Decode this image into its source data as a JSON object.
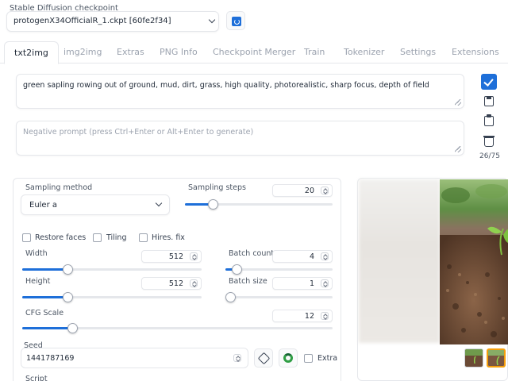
{
  "checkpoint": {
    "label": "Stable Diffusion checkpoint",
    "value": "protogenX34OfficialR_1.ckpt [60fe2f34]"
  },
  "tabs": [
    {
      "label": "txt2img",
      "active": true
    },
    {
      "label": "img2img"
    },
    {
      "label": "Extras"
    },
    {
      "label": "PNG Info"
    },
    {
      "label": "Checkpoint Merger"
    },
    {
      "label": "Train"
    },
    {
      "label": "Tokenizer"
    },
    {
      "label": "Settings"
    },
    {
      "label": "Extensions"
    }
  ],
  "prompt": {
    "value": "green sapling rowing out of ground, mud, dirt, grass, high quality, photorealistic, sharp focus, depth of field",
    "negative_placeholder": "Negative prompt (press Ctrl+Enter or Alt+Enter to generate)",
    "token_count": "26/75"
  },
  "tools": [
    {
      "icon": "checkbox-check-icon"
    },
    {
      "icon": "save-icon"
    },
    {
      "icon": "clipboard-icon"
    },
    {
      "icon": "trash-icon"
    }
  ],
  "sampling": {
    "method_label": "Sampling method",
    "method_value": "Euler a",
    "steps_label": "Sampling steps",
    "steps_value": "20",
    "steps_fraction": 0.19
  },
  "checkboxes": {
    "restore_faces": "Restore faces",
    "tiling": "Tiling",
    "hires": "Hires. fix"
  },
  "size": {
    "width_label": "Width",
    "width_value": "512",
    "width_fraction": 0.25,
    "height_label": "Height",
    "height_value": "512",
    "height_fraction": 0.25
  },
  "batch": {
    "count_label": "Batch count",
    "count_value": "4",
    "count_fraction": 0.1,
    "size_label": "Batch size",
    "size_value": "1",
    "size_fraction": 0.0
  },
  "cfg": {
    "label": "CFG Scale",
    "value": "12",
    "fraction": 0.16
  },
  "seed": {
    "label": "Seed",
    "value": "1441787169",
    "dice_icon": "dice-icon",
    "recycle_icon": "recycle-icon",
    "extra_label": "Extra"
  },
  "script": {
    "label": "Script"
  },
  "colors": {
    "accent": "#1e6fd9"
  }
}
